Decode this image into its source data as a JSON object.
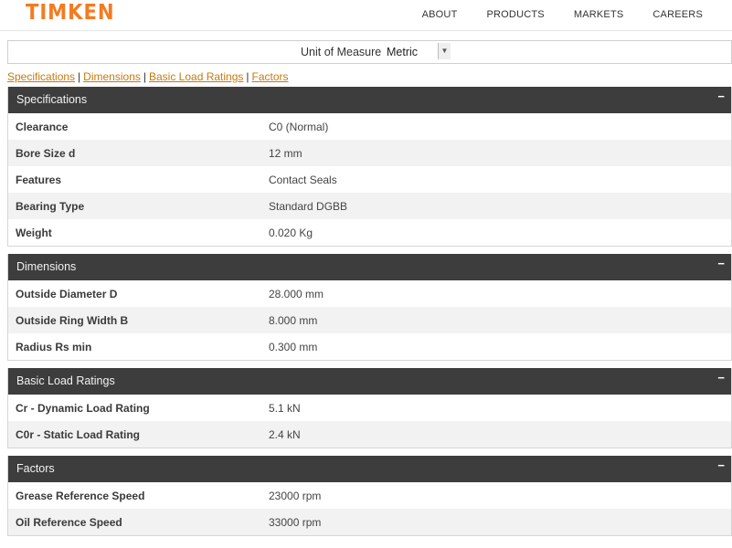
{
  "header": {
    "logo_text": "TIMKEN",
    "nav": [
      "ABOUT",
      "PRODUCTS",
      "MARKETS",
      "CAREERS"
    ]
  },
  "unit_of_measure": {
    "label": "Unit of Measure",
    "selected": "Metric"
  },
  "jump_links": [
    "Specifications",
    "Dimensions",
    "Basic Load Ratings",
    "Factors"
  ],
  "sections": [
    {
      "title": "Specifications",
      "toggle": "−",
      "rows": [
        {
          "label": "Clearance",
          "value": "C0 (Normal)"
        },
        {
          "label": "Bore Size d",
          "value": "12 mm"
        },
        {
          "label": "Features",
          "value": "Contact Seals"
        },
        {
          "label": "Bearing Type",
          "value": "Standard DGBB"
        },
        {
          "label": "Weight",
          "value": "0.020 Kg"
        }
      ]
    },
    {
      "title": "Dimensions",
      "toggle": "−",
      "rows": [
        {
          "label": "Outside Diameter D",
          "value": "28.000 mm"
        },
        {
          "label": "Outside Ring Width B",
          "value": "8.000 mm"
        },
        {
          "label": "Radius Rs min",
          "value": "0.300 mm"
        }
      ]
    },
    {
      "title": "Basic Load Ratings",
      "toggle": "−",
      "rows": [
        {
          "label": "Cr - Dynamic Load Rating",
          "value": "5.1 kN"
        },
        {
          "label": "C0r - Static Load Rating",
          "value": "2.4 kN"
        }
      ]
    },
    {
      "title": "Factors",
      "toggle": "−",
      "rows": [
        {
          "label": "Grease Reference Speed",
          "value": "23000 rpm"
        },
        {
          "label": "Oil Reference Speed",
          "value": "33000 rpm"
        }
      ]
    }
  ],
  "colors": {
    "brand_orange": "#f47b20",
    "link": "#c87a0c",
    "section_header_bg": "#3d3d3d",
    "row_alt_bg": "#f2f2f2"
  }
}
